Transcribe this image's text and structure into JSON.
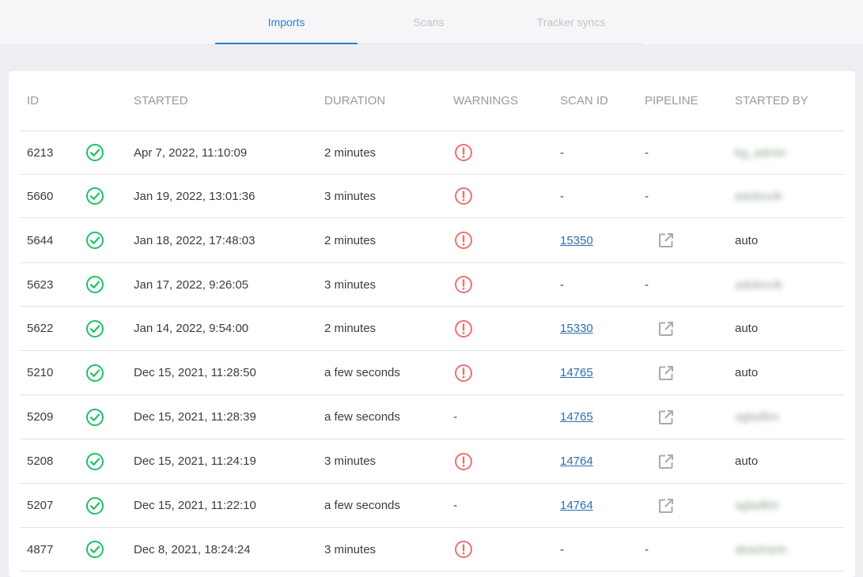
{
  "tabs": [
    {
      "label": "Imports",
      "active": true
    },
    {
      "label": "Scans",
      "active": false
    },
    {
      "label": "Tracker syncs",
      "active": false
    }
  ],
  "colors": {
    "accent": "#2b7fd0",
    "success": "#1fbf6b",
    "warning": "#f07070",
    "link": "#2b6fb0"
  },
  "table": {
    "headers": [
      "ID",
      "",
      "STARTED",
      "DURATION",
      "WARNINGS",
      "SCAN ID",
      "PIPELINE",
      "STARTED BY"
    ],
    "rows": [
      {
        "id": "6213",
        "status": "check-circle-icon",
        "started": "Apr 7, 2022, 11:10:09",
        "duration": "2 minutes",
        "warning": true,
        "scan_id": "-",
        "pipeline": "-",
        "started_by": "kg_admin",
        "started_by_blurred": true
      },
      {
        "id": "5660",
        "status": "check-circle-icon",
        "started": "Jan 19, 2022, 13:01:36",
        "duration": "3 minutes",
        "warning": true,
        "scan_id": "-",
        "pipeline": "-",
        "started_by": "adubovik",
        "started_by_blurred": true
      },
      {
        "id": "5644",
        "status": "check-circle-icon",
        "started": "Jan 18, 2022, 17:48:03",
        "duration": "2 minutes",
        "warning": true,
        "scan_id": "15350",
        "pipeline": "external-link-icon",
        "started_by": "auto",
        "started_by_blurred": false
      },
      {
        "id": "5623",
        "status": "check-circle-icon",
        "started": "Jan 17, 2022, 9:26:05",
        "duration": "3 minutes",
        "warning": true,
        "scan_id": "-",
        "pipeline": "-",
        "started_by": "adubovik",
        "started_by_blurred": true
      },
      {
        "id": "5622",
        "status": "check-circle-icon",
        "started": "Jan 14, 2022, 9:54:00",
        "duration": "2 minutes",
        "warning": true,
        "scan_id": "15330",
        "pipeline": "external-link-icon",
        "started_by": "auto",
        "started_by_blurred": false
      },
      {
        "id": "5210",
        "status": "check-circle-icon",
        "started": "Dec 15, 2021, 11:28:50",
        "duration": "a few seconds",
        "warning": true,
        "scan_id": "14765",
        "pipeline": "external-link-icon",
        "started_by": "auto",
        "started_by_blurred": false
      },
      {
        "id": "5209",
        "status": "check-circle-icon",
        "started": "Dec 15, 2021, 11:28:39",
        "duration": "a few seconds",
        "warning": false,
        "scan_id": "14765",
        "pipeline": "external-link-icon",
        "started_by": "agladkin",
        "started_by_blurred": true
      },
      {
        "id": "5208",
        "status": "check-circle-icon",
        "started": "Dec 15, 2021, 11:24:19",
        "duration": "3 minutes",
        "warning": true,
        "scan_id": "14764",
        "pipeline": "external-link-icon",
        "started_by": "auto",
        "started_by_blurred": false
      },
      {
        "id": "5207",
        "status": "check-circle-icon",
        "started": "Dec 15, 2021, 11:22:10",
        "duration": "a few seconds",
        "warning": false,
        "scan_id": "14764",
        "pipeline": "external-link-icon",
        "started_by": "agladkin",
        "started_by_blurred": true
      },
      {
        "id": "4877",
        "status": "check-circle-icon",
        "started": "Dec 8, 2021, 18:24:24",
        "duration": "3 minutes",
        "warning": true,
        "scan_id": "-",
        "pipeline": "-",
        "started_by": "abasharin",
        "started_by_blurred": true
      }
    ]
  }
}
